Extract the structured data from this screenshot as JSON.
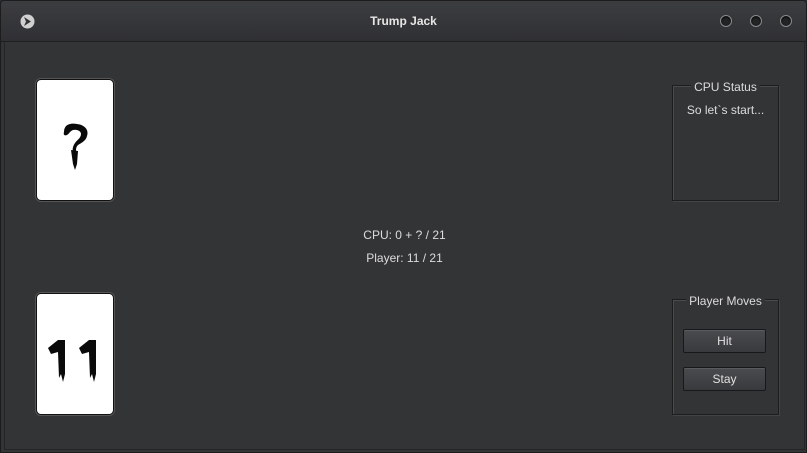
{
  "window": {
    "title": "Trump Jack",
    "app_icon": "app-logo-icon",
    "controls": [
      "minimize-icon",
      "maximize-icon",
      "close-icon"
    ]
  },
  "cards": {
    "cpu": {
      "face": "?",
      "icon": "question-glyph-icon"
    },
    "player": {
      "face": "11",
      "icon": "number-eleven-glyph-icon"
    }
  },
  "scores": {
    "cpu": "CPU:  0 + ? / 21",
    "player": "Player: 11 / 21"
  },
  "cpu_status": {
    "label": "CPU Status",
    "text": "So let`s start..."
  },
  "player_moves": {
    "label": "Player Moves",
    "hit_label": "Hit",
    "stay_label": "Stay"
  },
  "colors": {
    "background": "#333436",
    "text": "#dcdcdc",
    "card": "#ffffff"
  }
}
